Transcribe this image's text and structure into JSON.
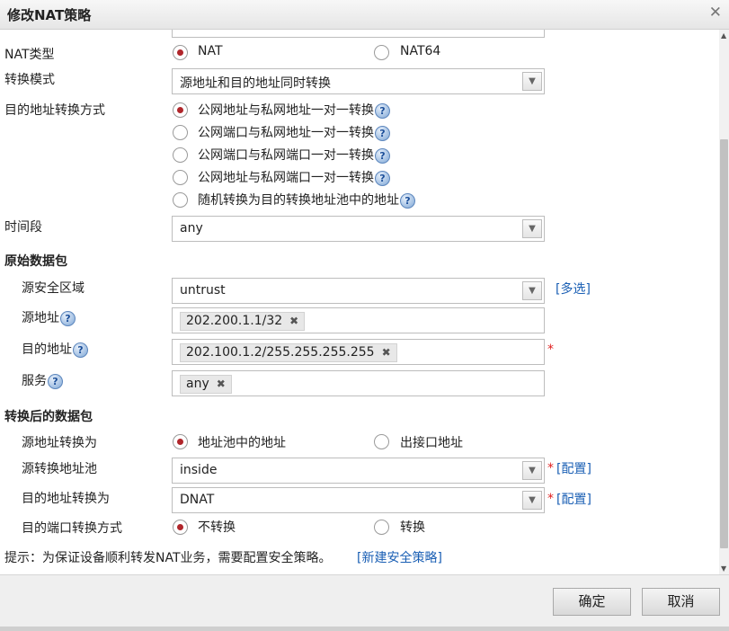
{
  "dialog": {
    "title": "修改NAT策略"
  },
  "nat_type": {
    "label": "NAT类型",
    "options": [
      {
        "label": "NAT",
        "selected": true
      },
      {
        "label": "NAT64",
        "selected": false
      }
    ]
  },
  "convert_mode": {
    "label": "转换模式",
    "value": "源地址和目的地址同时转换"
  },
  "dst_convert_method": {
    "label": "目的地址转换方式",
    "options": [
      {
        "label": "公网地址与私网地址一对一转换",
        "selected": true
      },
      {
        "label": "公网端口与私网地址一对一转换",
        "selected": false
      },
      {
        "label": "公网端口与私网端口一对一转换",
        "selected": false
      },
      {
        "label": "公网地址与私网端口一对一转换",
        "selected": false
      },
      {
        "label": "随机转换为目的转换地址池中的地址",
        "selected": false
      }
    ]
  },
  "time_range": {
    "label": "时间段",
    "value": "any"
  },
  "original_packet": {
    "heading": "原始数据包",
    "src_zone": {
      "label": "源安全区域",
      "value": "untrust",
      "link": "[多选]"
    },
    "src_addr": {
      "label": "源地址",
      "tag": "202.200.1.1/32"
    },
    "dst_addr": {
      "label": "目的地址",
      "tag": "202.100.1.2/255.255.255.255",
      "required": "*"
    },
    "service": {
      "label": "服务",
      "tag": "any"
    }
  },
  "converted_packet": {
    "heading": "转换后的数据包",
    "src_convert": {
      "label": "源地址转换为",
      "options": [
        {
          "label": "地址池中的地址",
          "selected": true
        },
        {
          "label": "出接口地址",
          "selected": false
        }
      ]
    },
    "src_pool": {
      "label": "源转换地址池",
      "value": "inside",
      "required": "*",
      "link": "[配置]"
    },
    "dst_convert": {
      "label": "目的地址转换为",
      "value": "DNAT",
      "required": "*",
      "link": "[配置]"
    },
    "dst_port_method": {
      "label": "目的端口转换方式",
      "options": [
        {
          "label": "不转换",
          "selected": true
        },
        {
          "label": "转换",
          "selected": false
        }
      ]
    }
  },
  "hint": {
    "text": "提示：为保证设备顺利转发NAT业务，需要配置安全策略。",
    "link": "[新建安全策略]"
  },
  "footer": {
    "ok": "确定",
    "cancel": "取消"
  },
  "icons": {
    "help": "question-help-icon",
    "close": "close-icon",
    "dropdown": "chevron-down-icon",
    "remove": "remove-tag-icon"
  },
  "colors": {
    "radio_selected": "#b0262b",
    "link": "#1a5fb4",
    "required": "#e02020"
  }
}
